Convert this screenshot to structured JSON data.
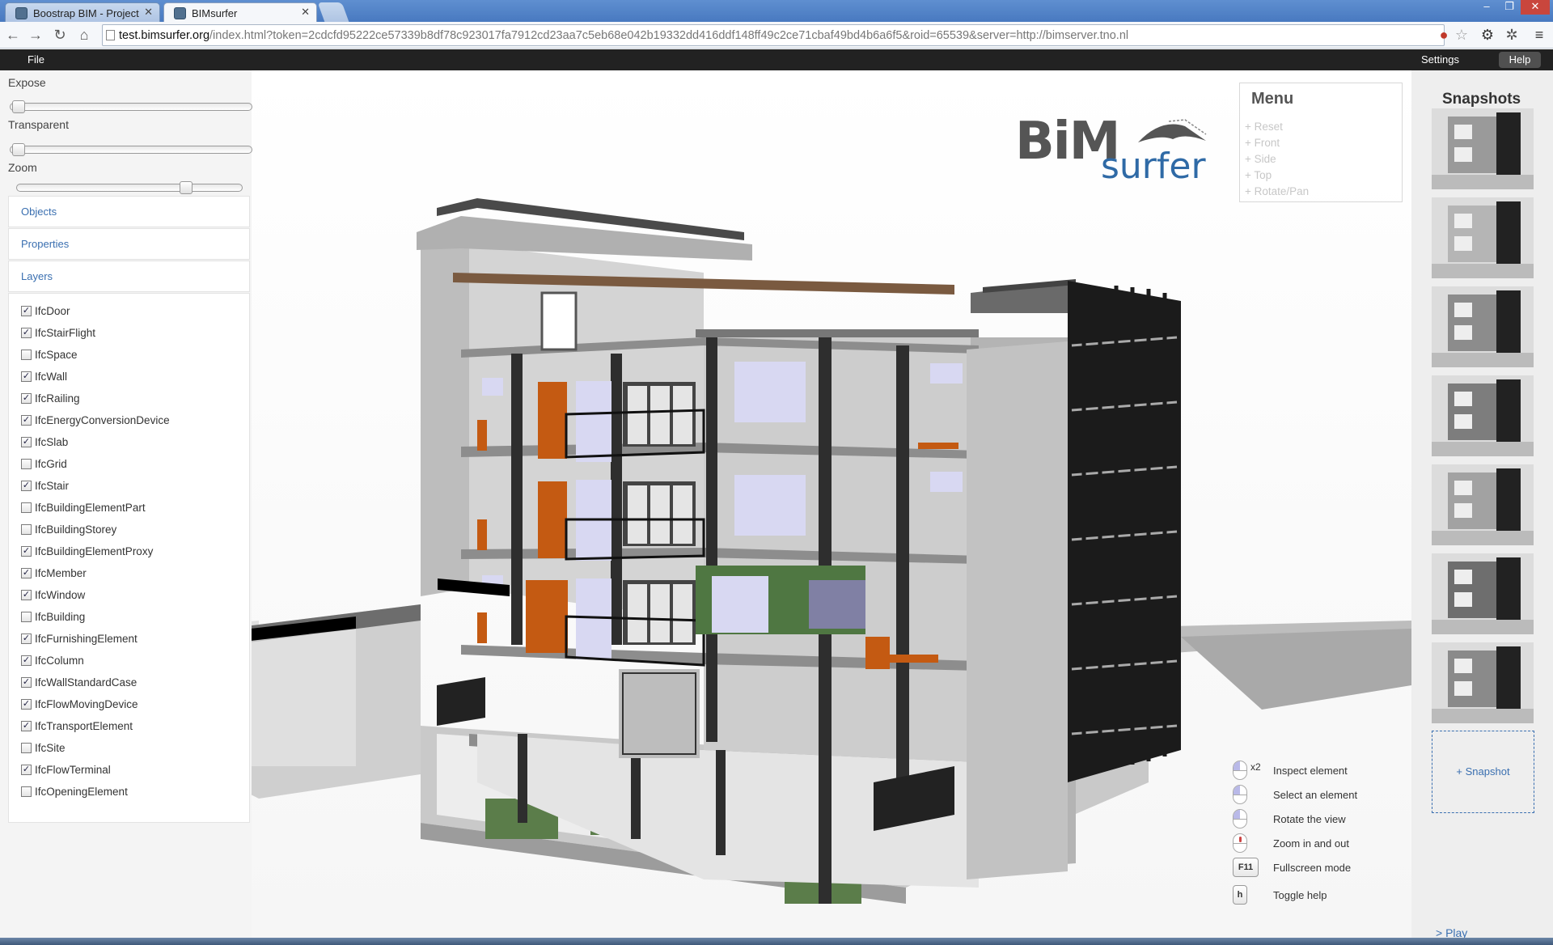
{
  "browser": {
    "tabs": [
      {
        "title": "Boostrap BIM - Project",
        "active": false
      },
      {
        "title": "BIMsurfer",
        "active": true
      }
    ],
    "url_host": "test.bimsurfer.org",
    "url_rest": "/index.html?token=2cdcfd95222ce57339b8df78c923017fa7912cd23aa7c5eb68e042b19332dd416ddf148ff49c2ce71cbaf49bd4b6a6f5&roid=65539&server=http://bimserver.tno.nl",
    "window_controls": [
      "–",
      "❐",
      "✕"
    ]
  },
  "menubar": {
    "file": "File",
    "settings": "Settings",
    "help": "Help"
  },
  "left_panel": {
    "expose_label": "Expose",
    "transparent_label": "Transparent",
    "zoom_label": "Zoom",
    "expose_value": 0.0,
    "transparent_value": 0.0,
    "zoom_value": 0.74,
    "objects": "Objects",
    "properties": "Properties",
    "layers": "Layers",
    "layer_items": [
      {
        "name": "IfcDoor",
        "checked": true
      },
      {
        "name": "IfcStairFlight",
        "checked": true
      },
      {
        "name": "IfcSpace",
        "checked": false
      },
      {
        "name": "IfcWall",
        "checked": true
      },
      {
        "name": "IfcRailing",
        "checked": true
      },
      {
        "name": "IfcEnergyConversionDevice",
        "checked": true
      },
      {
        "name": "IfcSlab",
        "checked": true
      },
      {
        "name": "IfcGrid",
        "checked": false
      },
      {
        "name": "IfcStair",
        "checked": true
      },
      {
        "name": "IfcBuildingElementPart",
        "checked": false
      },
      {
        "name": "IfcBuildingStorey",
        "checked": false
      },
      {
        "name": "IfcBuildingElementProxy",
        "checked": true
      },
      {
        "name": "IfcMember",
        "checked": true
      },
      {
        "name": "IfcWindow",
        "checked": true
      },
      {
        "name": "IfcBuilding",
        "checked": false
      },
      {
        "name": "IfcFurnishingElement",
        "checked": true
      },
      {
        "name": "IfcColumn",
        "checked": true
      },
      {
        "name": "IfcWallStandardCase",
        "checked": true
      },
      {
        "name": "IfcFlowMovingDevice",
        "checked": true
      },
      {
        "name": "IfcTransportElement",
        "checked": true
      },
      {
        "name": "IfcSite",
        "checked": false
      },
      {
        "name": "IfcFlowTerminal",
        "checked": true
      },
      {
        "name": "IfcOpeningElement",
        "checked": false
      }
    ]
  },
  "menu": {
    "title": "Menu",
    "items": [
      "+ Reset",
      "+ Front",
      "+ Side",
      "+ Top",
      "+ Rotate/Pan"
    ]
  },
  "logo": {
    "line1": "BiM",
    "line2": "surfer"
  },
  "help_legend": [
    {
      "icon": "mouse-double-left-icon",
      "extra": "x2",
      "text": "Inspect element"
    },
    {
      "icon": "mouse-left-icon",
      "text": "Select an element"
    },
    {
      "icon": "mouse-left-icon",
      "text": "Rotate the view"
    },
    {
      "icon": "mouse-wheel-icon",
      "text": "Zoom in and out"
    },
    {
      "icon": "key-f11-icon",
      "key": "F11",
      "text": "Fullscreen mode"
    },
    {
      "icon": "key-h-icon",
      "key": "h",
      "text": "Toggle help"
    }
  ],
  "snapshots": {
    "title": "Snapshots",
    "add": "+ Snapshot",
    "play": "> Play",
    "count": 7
  },
  "colors": {
    "menubar_bg": "#222222",
    "link": "#3a6fb0",
    "logo_gray": "#555555",
    "logo_blue": "#2f6aa6"
  }
}
